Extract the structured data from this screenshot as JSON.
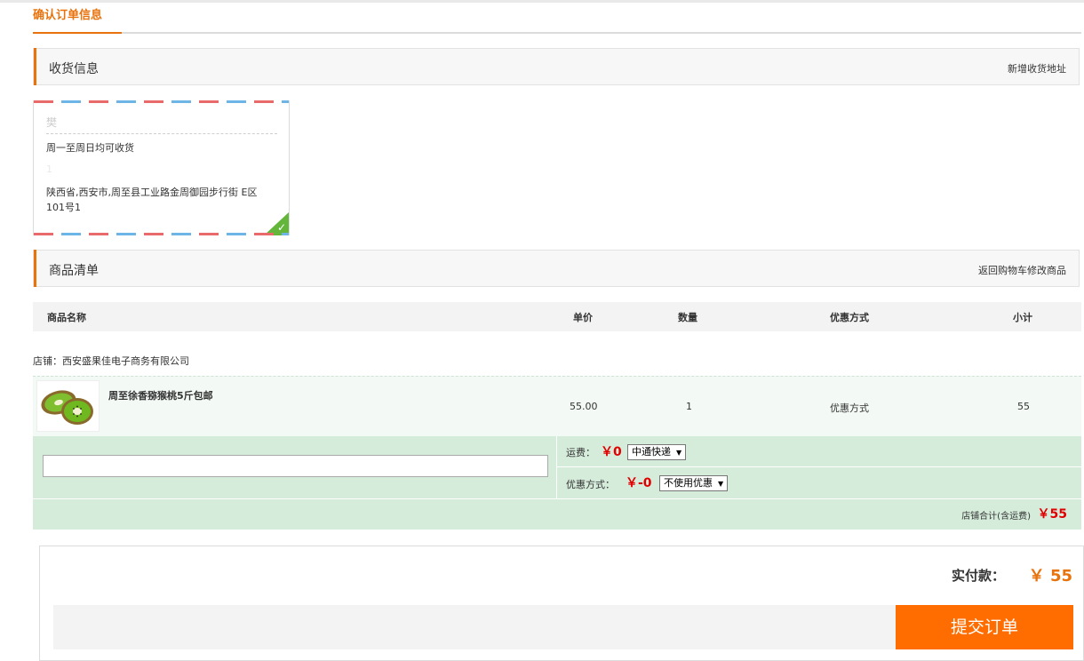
{
  "page": {
    "title": "确认订单信息"
  },
  "shipping_section": {
    "title": "收货信息",
    "add_address_link": "新增收货地址"
  },
  "address_card": {
    "name": "樊",
    "receive_time": "周一至周日均可收货",
    "phone": "1",
    "address": "陕西省,西安市,周至县工业路金周御园步行街 E区 101号1",
    "selected_icon": "check-icon"
  },
  "goods_section": {
    "title": "商品清单",
    "back_link": "返回购物车修改商品"
  },
  "table": {
    "headers": [
      "商品名称",
      "单价",
      "数量",
      "优惠方式",
      "小计"
    ]
  },
  "shop": {
    "label": "店铺：西安盛果佳电子商务有限公司"
  },
  "product": {
    "name": "周至徐香猕猴桃5斤包邮",
    "price": "55.00",
    "quantity": "1",
    "discount": "优惠方式",
    "subtotal": "55",
    "image_icon": "kiwi-fruit-image"
  },
  "extras": {
    "memo_value": "",
    "shipping_label": "运费：",
    "shipping_fee": "￥0",
    "shipping_method": "中通快递",
    "coupon_label": "优惠方式：",
    "coupon_amount": "￥-0",
    "coupon_option": "不使用优惠",
    "shop_total_label": "店铺合计(含运费)",
    "shop_total": "￥55"
  },
  "payment": {
    "label": "实付款：",
    "amount": "￥  55",
    "submit_label": "提交订单"
  },
  "colors": {
    "accent": "#e8720c",
    "price_red": "#e10000",
    "submit_bg": "#ff6d00",
    "row_green": "#d5ecdb"
  }
}
